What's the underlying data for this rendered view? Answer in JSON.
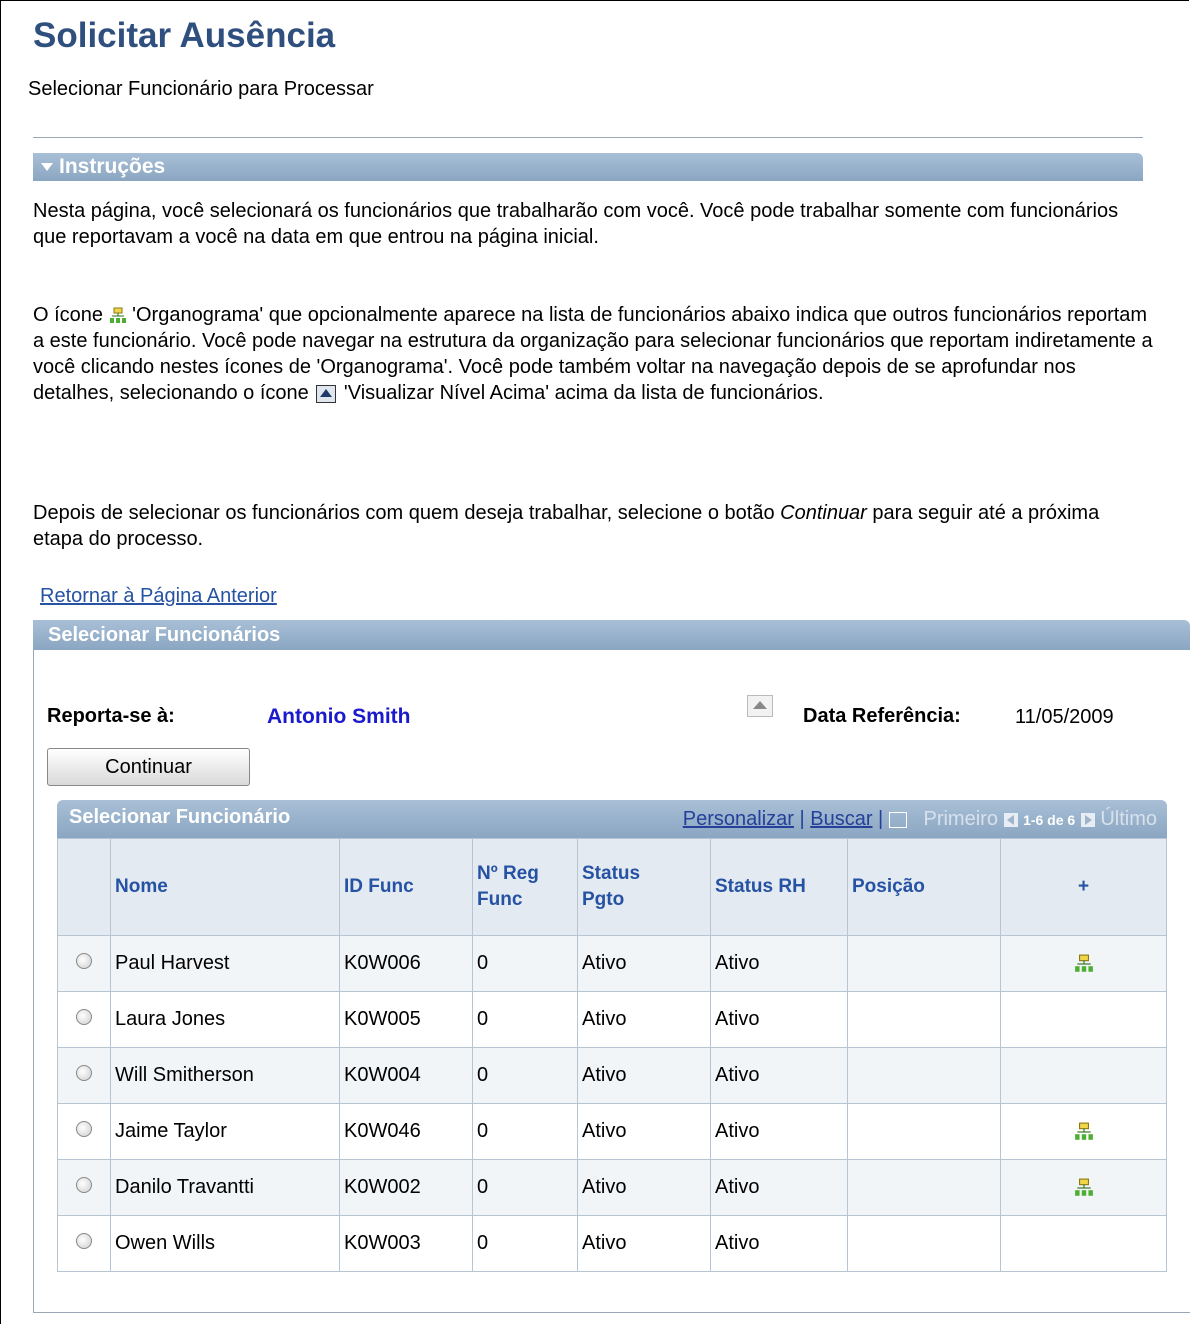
{
  "page": {
    "title": "Solicitar Ausência",
    "subtitle": "Selecionar Funcionário para Processar"
  },
  "instructions": {
    "header": "Instruções",
    "p1": "Nesta página, você selecionará os funcionários que trabalharão com você. Você pode trabalhar somente com funcionários que reportavam a você na data em que entrou na página inicial.",
    "p2_a": "O ícone",
    "p2_b": "'Organograma' que opcionalmente aparece na lista de funcionários abaixo indica que outros funcionários reportam a este funcionário. Você pode navegar na estrutura da organização para selecionar funcionários que reportam indiretamente a você clicando nestes ícones de 'Organograma'. Você pode também voltar na navegação depois de se aprofundar nos detalhes, selecionando o ícone",
    "p2_c": "'Visualizar Nível Acima' acima da lista de funcionários.",
    "p3_a": "Depois de selecionar os funcionários com quem deseja trabalhar, selecione o botão",
    "p3_em": "Continuar",
    "p3_b": "para seguir até a próxima etapa do processo."
  },
  "return_link": "Retornar à Página Anterior",
  "selection": {
    "header": "Selecionar Funcionários",
    "reports_to_label": "Reporta-se à:",
    "reports_to_name": "Antonio Smith",
    "ref_date_label": "Data Referência:",
    "ref_date_value": "11/05/2009",
    "continue_label": "Continuar"
  },
  "grid": {
    "title": "Selecionar Funcionário",
    "personalize": "Personalizar",
    "search": "Buscar",
    "first": "Primeiro",
    "range": "1-6 de 6",
    "last": "Último",
    "columns": {
      "name": "Nome",
      "id": "ID Func",
      "reg_1": "Nº Reg",
      "reg_2": "Func",
      "pay_1": "Status",
      "pay_2": "Pgto",
      "hr": "Status RH",
      "position": "Posição",
      "plus": "+"
    },
    "rows": [
      {
        "name": "Paul Harvest",
        "id": "K0W006",
        "reg": "0",
        "pay": "Ativo",
        "hr": "Ativo",
        "position": "",
        "org": true
      },
      {
        "name": "Laura Jones",
        "id": "K0W005",
        "reg": "0",
        "pay": "Ativo",
        "hr": "Ativo",
        "position": "",
        "org": false
      },
      {
        "name": "Will Smitherson",
        "id": "K0W004",
        "reg": "0",
        "pay": "Ativo",
        "hr": "Ativo",
        "position": "",
        "org": false
      },
      {
        "name": "Jaime Taylor",
        "id": "K0W046",
        "reg": "0",
        "pay": "Ativo",
        "hr": "Ativo",
        "position": "",
        "org": true
      },
      {
        "name": "Danilo Travantti",
        "id": "K0W002",
        "reg": "0",
        "pay": "Ativo",
        "hr": "Ativo",
        "position": "",
        "org": true
      },
      {
        "name": "Owen Wills",
        "id": "K0W003",
        "reg": "0",
        "pay": "Ativo",
        "hr": "Ativo",
        "position": "",
        "org": false
      }
    ]
  },
  "icons": {
    "org_chart": "org-chart-icon",
    "view_level_up": "view-level-up-icon"
  },
  "colors": {
    "title": "#2f4f7f",
    "bar": "#8ba6c2",
    "link": "#2652a3",
    "manager": "#1a1acc"
  }
}
